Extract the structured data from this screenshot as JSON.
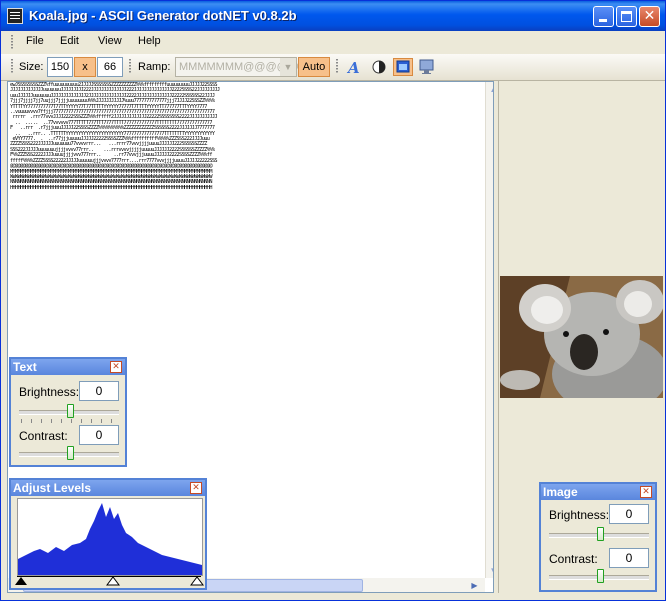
{
  "window": {
    "title": "Koala.jpg - ASCII Generator dotNET v0.8.2b"
  },
  "menu": {
    "items": [
      "File",
      "Edit",
      "View",
      "Help"
    ]
  },
  "toolbar": {
    "size_label": "Size:",
    "width": "150",
    "x_label": "x",
    "height": "66",
    "ramp_label": "Ramp:",
    "ramp_value": "MMMMMMM@@@@@@@",
    "auto_label": "Auto"
  },
  "ascii_art": "ewJSSSSSSSSZZZ%ffuuuuuuuuuu2JJJJJSSSSSSSZZZZZZZZZZ%%%fffffffffuuuuuuuuuJJJJJ22SSSS\nJJJJJJJJJJJJJuuuuuuuJJJJJJJJJ222JJJJJJJJJJJJJJ222JJJJJJJJJJJJJJJ2222SSSS22JJJJJJJJJ\nuuuJJJJJJuuuuuuuJJJJJJJJJJJJJJ2JJJJJJJJJJJJJJJ2222JJJJJJJJJJJJJJ22222SSSSSS22JJJJ\n7jjj7jjjj7jj7uujjj7jjjjuuuuuuuu%%%JJJJJJJJJJJ%uuu7777777777777jjj7JJJJ22SSSZZ%%%%\nYTTTTYY7777777777T77TTYYYYY77T77TTTTTYYYYYY77777T7TTTTYYYYYTT777777TTTYYYY7777\n..vuuuuvvvv7ffjjj7777777777777777777777777777777777777777777777777777777777777777\n rrrrr  .rrr77vvvJJJJ2222SSSZZZ%%%ffffff2JJJJJJJJJJJJJ22222SSSSSSSS2222JJJJJJJJJJJ\n  ..  .....  ..77vvvvvv777TTTTT777TTT7777TTTT7777777777777TTTTTTTT77777777777777\nF   ..rrr  .r7jjjuuuJJJJJ22SSSSZZZZ%%%%%%%%%%ZZZZZZZZZZZZSSSSSS2222JJJJJJJ7777777\n  ..   ..rrr.. .TTTTTTYYYYYYYYYYYYYYYYYYYYYYY7777777777777777TTTTTTTTYYYYYYYYYYYY\n eVYY7777.  .  ..r77jjjuuuuuJJJJJ22222SSSSZZZ%%%ffffffffff%%%%%ZZZSSS222JJJJuuu\nZZZZSSSS222JJJJJJuuuuuuu77vvvvrrr...   ...rrrr77vvvjjjjuuuuJJJJJJ222SSSSSSZZZZ\nSSS222JJJJJuuuuuuujjjjvvvv77rrr..    ...rrrvvvvjjjjjuuuuuJJJJJJ2222SSSSSSZZZZZ%%%\nF%%ZZZSSS2222JJJJuuuujjjjvvv777rrr..     ..rr77vvvjjjuuuuJJJJJJ2222SSSSZZZZ%%%ff\nfffff%%%%ZZZZSSSS22222JJJJJuuuuuujjjvvvv7777rrr....rrr7777vvvjjjjuuuuJJJJJ22222SSS\n@@@@@@@@@@@@@@@@@@@@@@@@@@@@@@@@@@@@@@@@@@@@@@@@@@@@@@@@@@@@@@@@@@@@@@@@@@@@@@@@\nMMMMMMMMMMMMMMMMMMMMMMMMMMMMMMMMMMMMMMMMMMMMMMMMMMMMMMMMMMMMMMMMMMMMMMMMMMMMMMMM\nWWWWWWWWWWWWWWWWWWWWWWWWWWWWWWWWWWWWWWWWWWWWWWWWWWWWWWWWWWWWWWWWWWWWWWWWWWWWWWWW\nNNNNNNNNNNNNNNNNNNNNNNNNNNNNNNNNNNNNNNNNNNNNNNNNNNNNNNNNNNNNNNNNNNNNNNNNNNNNNNNN\nHHHHHHHHHHHHHHHHHHHHHHHHHHHHHHHHHHHHHHHHHHHHHHHHHHHHHHHHHHHHHHHHHHHHHHHHHHHHHHHH",
  "text_panel": {
    "title": "Text",
    "brightness_label": "Brightness:",
    "brightness": "0",
    "contrast_label": "Contrast:",
    "contrast": "0"
  },
  "levels_panel": {
    "title": "Adjust Levels"
  },
  "image_panel": {
    "title": "Image",
    "brightness_label": "Brightness:",
    "brightness": "0",
    "contrast_label": "Contrast:",
    "contrast": "0"
  }
}
